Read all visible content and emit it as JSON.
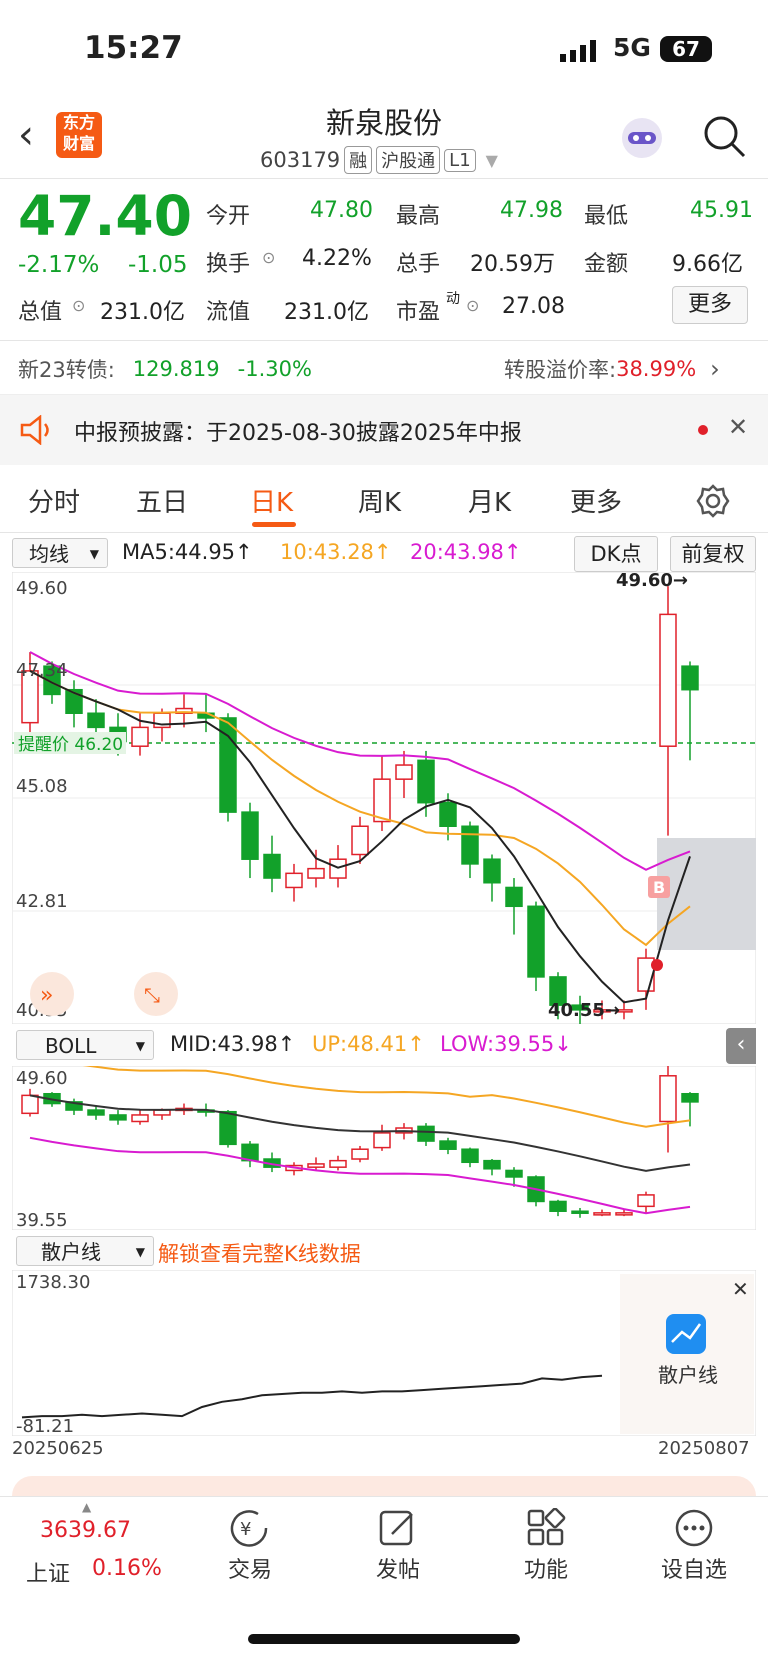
{
  "status": {
    "time": "15:27",
    "network": "5G",
    "battery": "67"
  },
  "header": {
    "title": "新泉股份",
    "code": "603179",
    "tags": [
      "融",
      "沪股通",
      "L1"
    ],
    "logo": [
      "东方",
      "财富"
    ]
  },
  "quote": {
    "price": "47.40",
    "change_pct": "-2.17%",
    "change": "-1.05",
    "open_label": "今开",
    "open": "47.80",
    "high_label": "最高",
    "high": "47.98",
    "low_label": "最低",
    "low": "45.91",
    "turnover_label": "换手",
    "turnover": "4.22%",
    "volume_label": "总手",
    "volume": "20.59万",
    "amount_label": "金额",
    "amount": "9.66亿",
    "mktcap_label": "总值",
    "mktcap": "231.0亿",
    "float_label": "流值",
    "float": "231.0亿",
    "pe_label": "市盈",
    "pe_sup": "动",
    "pe": "27.08",
    "more_button": "更多"
  },
  "bond": {
    "label": "新23转债:",
    "price": "129.819",
    "pct": "-1.30%",
    "premium_label": "转股溢价率:",
    "premium": "38.99%"
  },
  "notice": {
    "text": "中报预披露：于2025-08-30披露2025年中报"
  },
  "tabs": [
    "分时",
    "五日",
    "日K",
    "周K",
    "月K",
    "更多"
  ],
  "ma_bar": {
    "select": "均线",
    "ma5": "MA5:44.95↑",
    "ma10": "10:43.28↑",
    "ma20": "20:43.98↑",
    "dk": "DK点",
    "adj": "前复权"
  },
  "kchart": {
    "y_labels": [
      "49.60",
      "47.34",
      "45.08",
      "42.81",
      "40.55"
    ],
    "max_label": "49.60→",
    "min_label": "40.55→",
    "alert_label": "提醒价 46.20",
    "b_marker": "B"
  },
  "boll_bar": {
    "select": "BOLL",
    "mid": "MID:43.98↑",
    "up": "UP:48.41↑",
    "low": "LOW:39.55↓"
  },
  "boll_chart": {
    "y_top": "49.60",
    "y_bottom": "39.55"
  },
  "retail_bar": {
    "select": "散户线",
    "unlock": "解锁查看完整K线数据"
  },
  "retail_chart": {
    "y_top": "1738.30",
    "y_bottom": "-81.21",
    "date_start": "20250625",
    "date_end": "20250807",
    "overlay_label": "散户线"
  },
  "bottom_nav": {
    "index_value": "3639.67",
    "index_name": "上证",
    "index_pct": "0.16%",
    "items": [
      "交易",
      "发帖",
      "功能",
      "设自选"
    ]
  },
  "colors": {
    "up": "#e0202a",
    "down": "#12a12a",
    "ma10": "#f5a623",
    "ma20": "#d81bd0",
    "ma5": "#222222",
    "accent": "#f55a14"
  }
}
